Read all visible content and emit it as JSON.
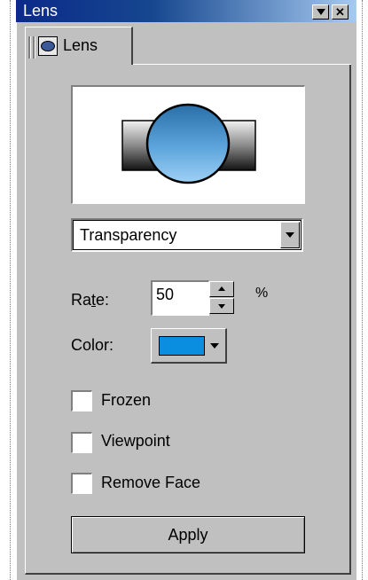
{
  "window": {
    "title": "Lens",
    "controls": [
      "pin-icon",
      "close-icon"
    ]
  },
  "tab": {
    "label": "Lens",
    "icon": "lens-icon"
  },
  "lens_type": {
    "selected": "Transparency"
  },
  "rate": {
    "label_pre": "Ra",
    "label_ul": "t",
    "label_post": "e:",
    "value": "50",
    "unit": "%"
  },
  "color": {
    "label": "Color:",
    "swatch": "#0a8fe0"
  },
  "options": [
    {
      "label": "Frozen",
      "checked": false
    },
    {
      "label": "Viewpoint",
      "checked": false
    },
    {
      "label": "Remove Face",
      "checked": false
    }
  ],
  "apply_label": "Apply",
  "colors": {
    "title_start": "#0b2a8a",
    "title_end": "#a6caf0",
    "face": "#c0c0c0",
    "lens_light": "#9ed0f5",
    "lens_dark": "#2a6fa8"
  }
}
